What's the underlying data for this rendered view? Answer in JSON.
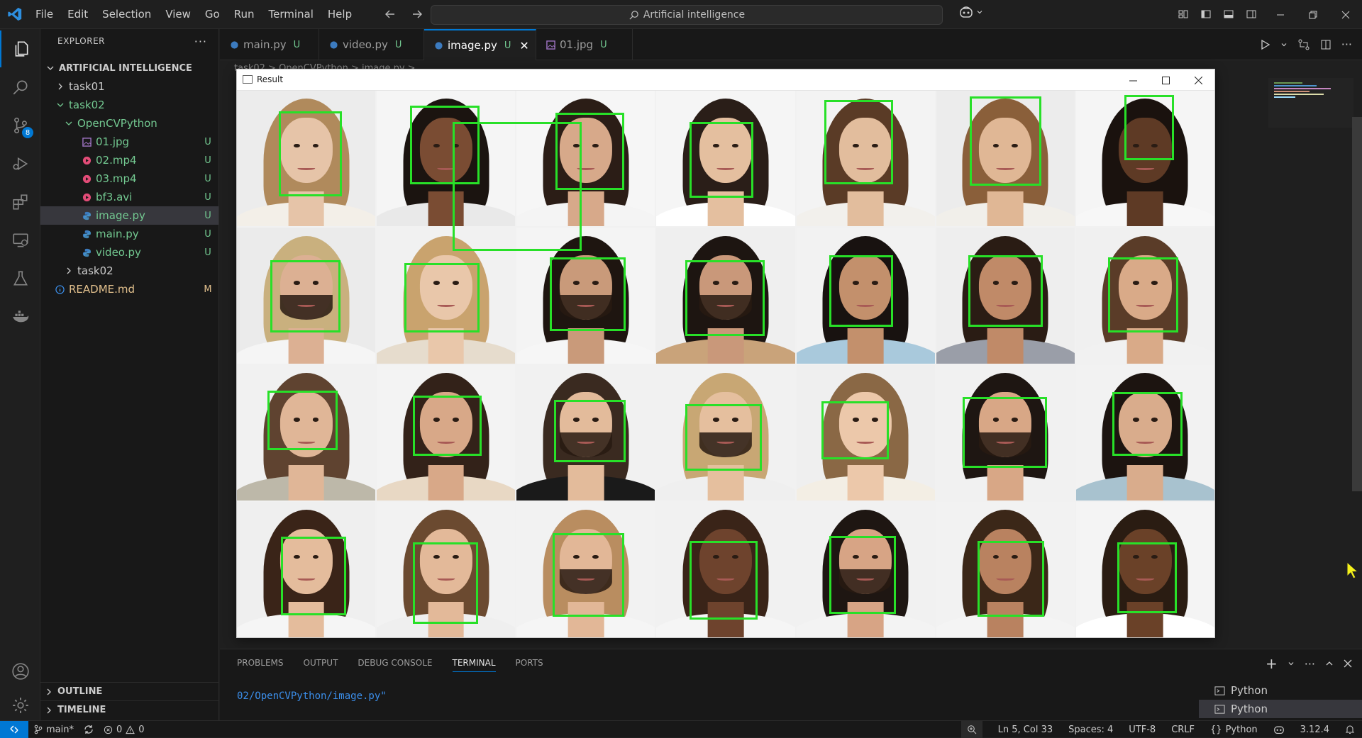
{
  "menu": [
    "File",
    "Edit",
    "Selection",
    "View",
    "Go",
    "Run",
    "Terminal",
    "Help"
  ],
  "command_center": {
    "text": "Artificial intelligence"
  },
  "explorer": {
    "title": "EXPLORER",
    "more": "···",
    "root": "ARTIFICIAL INTELLIGENCE",
    "items": [
      {
        "name": "task01",
        "status": ""
      },
      {
        "name": "task02",
        "status": ""
      },
      {
        "name": "OpenCVPython",
        "status": ""
      },
      {
        "name": "01.jpg",
        "status": "U"
      },
      {
        "name": "02.mp4",
        "status": "U"
      },
      {
        "name": "03.mp4",
        "status": "U"
      },
      {
        "name": "bf3.avi",
        "status": "U"
      },
      {
        "name": "image.py",
        "status": "U"
      },
      {
        "name": "main.py",
        "status": "U"
      },
      {
        "name": "video.py",
        "status": "U"
      },
      {
        "name": "task02",
        "status": ""
      },
      {
        "name": "README.md",
        "status": "M"
      }
    ],
    "outline": "OUTLINE",
    "timeline": "TIMELINE"
  },
  "activity_badge": "8",
  "tabs": [
    {
      "label": "main.py",
      "status": "U"
    },
    {
      "label": "video.py",
      "status": "U"
    },
    {
      "label": "image.py",
      "status": "U"
    },
    {
      "label": "01.jpg",
      "status": "U"
    }
  ],
  "breadcrumb": "task02 > OpenCVPython > image.py >",
  "result_window": {
    "title": "Result",
    "faces": [
      {
        "skin": "#e6c4a8",
        "hair": "#b08a5c",
        "shirt": "#f3efe8",
        "bg": "#ececec",
        "beard": false,
        "box": {
          "l": 30,
          "t": 15,
          "w": 46,
          "h": 63
        }
      },
      {
        "skin": "#7a4c33",
        "hair": "#1b1410",
        "shirt": "#e9e9e9",
        "bg": "#f5f5f5",
        "beard": false,
        "box": {
          "l": 24,
          "t": 11,
          "w": 50,
          "h": 58
        }
      },
      {
        "skin": "#d7a98a",
        "hair": "#2b1d16",
        "shirt": "#f4f4f4",
        "bg": "#f6f6f6",
        "beard": false,
        "box": {
          "l": 28,
          "t": 16,
          "w": 50,
          "h": 57
        }
      },
      {
        "skin": "#e4bf9f",
        "hair": "#2a1e18",
        "shirt": "#ffffff",
        "bg": "#f5f5f5",
        "beard": false,
        "box": {
          "l": 24,
          "t": 23,
          "w": 46,
          "h": 56
        }
      },
      {
        "skin": "#e2bd9d",
        "hair": "#5a3b26",
        "shirt": "#f2f0ec",
        "bg": "#f3f3f3",
        "beard": false,
        "box": {
          "l": 20,
          "t": 7,
          "w": 50,
          "h": 62
        }
      },
      {
        "skin": "#e0b795",
        "hair": "#8a5f3a",
        "shirt": "#f1efea",
        "bg": "#ececec",
        "beard": false,
        "box": {
          "l": 24,
          "t": 4,
          "w": 52,
          "h": 66
        }
      },
      {
        "skin": "#5e3a25",
        "hair": "#1a120e",
        "shirt": "#f7f7f7",
        "bg": "#f5f5f5",
        "beard": false,
        "box": {
          "l": 35,
          "t": 3,
          "w": 36,
          "h": 48
        }
      },
      {
        "skin": "#dcb093",
        "hair": "#c9b07e",
        "shirt": "#f5f5f5",
        "bg": "#ebebeb",
        "beard": true,
        "box": {
          "l": 24,
          "t": 24,
          "w": 51,
          "h": 53
        }
      },
      {
        "skin": "#e9c7aa",
        "hair": "#c9a36e",
        "shirt": "#e6dccd",
        "bg": "#f1f1f1",
        "beard": false,
        "box": {
          "l": 20,
          "t": 26,
          "w": 54,
          "h": 51
        }
      },
      {
        "skin": "#c99a7a",
        "hair": "#1e1510",
        "shirt": "#f6f6f6",
        "bg": "#f4f4f4",
        "beard": true,
        "box": {
          "l": 24,
          "t": 22,
          "w": 55,
          "h": 54
        }
      },
      {
        "skin": "#c9987a",
        "hair": "#1d1511",
        "shirt": "#c9a37a",
        "bg": "#efefef",
        "beard": true,
        "box": {
          "l": 21,
          "t": 24,
          "w": 57,
          "h": 56
        }
      },
      {
        "skin": "#c3906c",
        "hair": "#181210",
        "shirt": "#a9c9dc",
        "bg": "#f2f2f2",
        "beard": false,
        "box": {
          "l": 24,
          "t": 20,
          "w": 46,
          "h": 53
        }
      },
      {
        "skin": "#c08a68",
        "hair": "#2a1c14",
        "shirt": "#9a9ea8",
        "bg": "#eeeeee",
        "beard": false,
        "box": {
          "l": 23,
          "t": 20,
          "w": 54,
          "h": 53
        }
      },
      {
        "skin": "#d9aa88",
        "hair": "#5a3c28",
        "shirt": "#f1f1f1",
        "bg": "#f0f0f0",
        "beard": false,
        "box": {
          "l": 23,
          "t": 22,
          "w": 51,
          "h": 55
        }
      },
      {
        "skin": "#e0b697",
        "hair": "#5f4330",
        "shirt": "#bdb8a9",
        "bg": "#f1f1f1",
        "beard": false,
        "box": {
          "l": 22,
          "t": 19,
          "w": 51,
          "h": 44
        }
      },
      {
        "skin": "#d8a888",
        "hair": "#332219",
        "shirt": "#e8d8c4",
        "bg": "#f3f3f3",
        "beard": false,
        "box": {
          "l": 26,
          "t": 23,
          "w": 50,
          "h": 44
        }
      },
      {
        "skin": "#e3bb9b",
        "hair": "#3a2a20",
        "shirt": "#1a1a1a",
        "bg": "#f1f1f1",
        "beard": true,
        "box": {
          "l": 27,
          "t": 26,
          "w": 52,
          "h": 46
        }
      },
      {
        "skin": "#e5bf9e",
        "hair": "#c8a774",
        "shirt": "#efefef",
        "bg": "#f1f1f1",
        "beard": true,
        "box": {
          "l": 21,
          "t": 29,
          "w": 55,
          "h": 49
        }
      },
      {
        "skin": "#ecc8aa",
        "hair": "#8a6845",
        "shirt": "#f3eee4",
        "bg": "#efefef",
        "beard": false,
        "box": {
          "l": 18,
          "t": 27,
          "w": 49,
          "h": 43
        }
      },
      {
        "skin": "#d8a786",
        "hair": "#1e1612",
        "shirt": "#f1f1f1",
        "bg": "#f1f1f1",
        "beard": true,
        "box": {
          "l": 19,
          "t": 24,
          "w": 61,
          "h": 52
        }
      },
      {
        "skin": "#d9ac8c",
        "hair": "#1c1410",
        "shirt": "#a8c2cf",
        "bg": "#f2f2f2",
        "beard": false,
        "box": {
          "l": 26,
          "t": 20,
          "w": 51,
          "h": 47
        }
      },
      {
        "skin": "#e4bc9c",
        "hair": "#3a2418",
        "shirt": "#f5f5f5",
        "bg": "#efefef",
        "beard": false,
        "box": {
          "l": 32,
          "t": 26,
          "w": 47,
          "h": 58
        }
      },
      {
        "skin": "#e3b999",
        "hair": "#6b4a30",
        "shirt": "#efefef",
        "bg": "#f2f2f2",
        "beard": false,
        "box": {
          "l": 26,
          "t": 30,
          "w": 47,
          "h": 60
        }
      },
      {
        "skin": "#e2b797",
        "hair": "#b98d60",
        "shirt": "#f5f5f5",
        "bg": "#f2f2f2",
        "beard": true,
        "box": {
          "l": 26,
          "t": 23,
          "w": 52,
          "h": 62
        }
      },
      {
        "skin": "#6e432d",
        "hair": "#3a2418",
        "shirt": "#f5f5f5",
        "bg": "#f1f1f1",
        "beard": false,
        "box": {
          "l": 24,
          "t": 29,
          "w": 49,
          "h": 58
        }
      },
      {
        "skin": "#d7a485",
        "hair": "#1e1612",
        "shirt": "#f3f3f3",
        "bg": "#f1f1f1",
        "beard": true,
        "box": {
          "l": 24,
          "t": 25,
          "w": 48,
          "h": 58
        }
      },
      {
        "skin": "#b98260",
        "hair": "#3b2718",
        "shirt": "#f4f4f4",
        "bg": "#f2f2f2",
        "beard": false,
        "box": {
          "l": 30,
          "t": 29,
          "w": 48,
          "h": 56
        }
      },
      {
        "skin": "#6a4128",
        "hair": "#2a1c12",
        "shirt": "#ffffff",
        "bg": "#f4f4f4",
        "beard": false,
        "box": {
          "l": 30,
          "t": 30,
          "w": 43,
          "h": 52
        }
      }
    ]
  },
  "panel": {
    "tabs": [
      "PROBLEMS",
      "OUTPUT",
      "DEBUG CONSOLE",
      "TERMINAL",
      "PORTS"
    ],
    "active_tab": "TERMINAL",
    "terminal_line": "02/OpenCVPython/image.py\"",
    "terminals": [
      "Python",
      "Python"
    ]
  },
  "statusbar": {
    "branch": "main*",
    "errors": "0",
    "warnings": "0",
    "position": "Ln 5, Col 33",
    "spaces": "Spaces: 4",
    "encoding": "UTF-8",
    "eol": "CRLF",
    "language": "Python",
    "version": "3.12.4"
  }
}
